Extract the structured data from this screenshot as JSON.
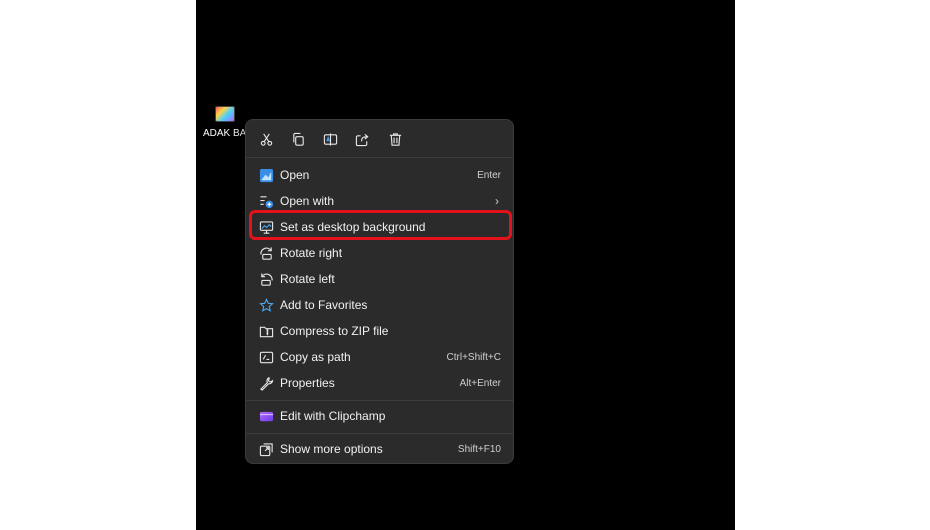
{
  "desktop": {
    "icon_label": "ADAK BA"
  },
  "quick_actions": [
    {
      "name": "cut-icon"
    },
    {
      "name": "copy-icon"
    },
    {
      "name": "rename-icon"
    },
    {
      "name": "share-icon"
    },
    {
      "name": "delete-icon"
    }
  ],
  "menu": {
    "items": [
      {
        "label": "Open",
        "shortcut": "Enter",
        "icon": "open-image-icon"
      },
      {
        "label": "Open with",
        "shortcut": "›",
        "icon": "open-with-icon"
      },
      {
        "label": "Set as desktop background",
        "shortcut": "",
        "icon": "desktop-background-icon"
      },
      {
        "label": "Rotate right",
        "shortcut": "",
        "icon": "rotate-right-icon"
      },
      {
        "label": "Rotate left",
        "shortcut": "",
        "icon": "rotate-left-icon"
      },
      {
        "label": "Add to Favorites",
        "shortcut": "",
        "icon": "star-icon"
      },
      {
        "label": "Compress to ZIP file",
        "shortcut": "",
        "icon": "zip-folder-icon"
      },
      {
        "label": "Copy as path",
        "shortcut": "Ctrl+Shift+C",
        "icon": "copy-path-icon"
      },
      {
        "label": "Properties",
        "shortcut": "Alt+Enter",
        "icon": "wrench-icon"
      },
      {
        "label": "Edit with Clipchamp",
        "shortcut": "",
        "icon": "clipchamp-icon"
      },
      {
        "label": "Show more options",
        "shortcut": "Shift+F10",
        "icon": "more-options-icon"
      }
    ]
  },
  "colors": {
    "menu_background": "#2b2b2b",
    "highlight_border": "#e3121b",
    "accent_blue": "#4ca6f0"
  }
}
